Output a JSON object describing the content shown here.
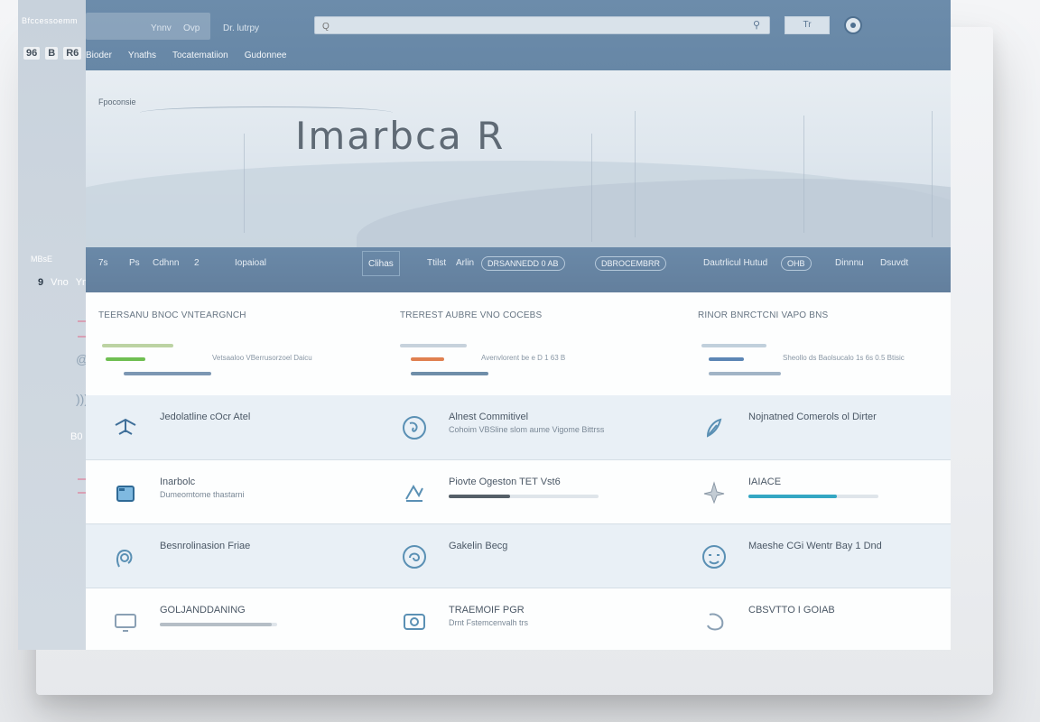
{
  "rail": {
    "brand": "Bfccessoemm",
    "tools": [
      "96",
      "B",
      "R6"
    ],
    "section": "MBsE",
    "nav": [
      "9",
      "Vno",
      "Ynno"
    ],
    "badge": "B0"
  },
  "topbar": {
    "links": [
      "Ynnv",
      "Ovp",
      "Dr. lutrpy"
    ],
    "search": {
      "placeholder": "Q",
      "icon": "search-icon"
    },
    "button_label": "Tr",
    "subnav": [
      "Bioder",
      "Ynaths",
      "Tocatematiion",
      "Gudonnee"
    ]
  },
  "hero": {
    "kicker": "Fpoconsie",
    "title": "Imarbca R"
  },
  "toolbar": {
    "items": [
      "7s",
      "Ps",
      "Cdhnn",
      "2"
    ],
    "filter_label": "Iopaioal",
    "box1": "Clihas",
    "box2_prefix": "Ttilst",
    "box2_label": "Arlin",
    "pill1": "DRSANNEDD 0 AB",
    "pill2": "DBROCEMBRR",
    "link1": "Dautrlicul Hutud",
    "pill3": "OHB",
    "link2": "Dinnnu",
    "link3": "Dsuvdt"
  },
  "summary": [
    {
      "title": "TEERSANU BNOC VNTEARGNCH",
      "note": "Vetsaaloo VBerrusorzoel Daicu",
      "bars": [
        {
          "color": "#bcd3a3",
          "value": 0.55
        },
        {
          "color": "#6fbf52",
          "value": 0.31
        },
        {
          "color": "#7c97b3",
          "value": 0.68
        }
      ]
    },
    {
      "title": "TREREST AUBRE VNO COCEBS",
      "note": "Avenvlorent be e D 1 63 B",
      "bars": [
        {
          "color": "#c7d2dc",
          "value": 0.52
        },
        {
          "color": "#e08050",
          "value": 0.26
        },
        {
          "color": "#6f8ea9",
          "value": 0.6
        }
      ]
    },
    {
      "title": "RINOR BNRCTCNI VAPO BNS",
      "note": "Sheollo ds Baolsucalo 1s 6s 0.5 Btisic",
      "bars": [
        {
          "color": "#c1d0dc",
          "value": 0.5
        },
        {
          "color": "#5c86b5",
          "value": 0.27
        },
        {
          "color": "#a1b4c6",
          "value": 0.56
        }
      ]
    }
  ],
  "rows": [
    {
      "style": "alt",
      "cells": [
        {
          "icon": "windmill-icon",
          "title": "Jedolatline cOcr Atel",
          "sub": ""
        },
        {
          "icon": "compass-icon",
          "title": "Alnest Commitivel",
          "sub": "Cohoim VBSline slom aume Vigome Bittrss"
        },
        {
          "icon": "feather-icon",
          "title": "Nojnatned Comerols ol Dirter",
          "sub": ""
        }
      ]
    },
    {
      "style": "white",
      "cells": [
        {
          "icon": "folder-icon",
          "title": "Inarbolc",
          "sub": "Dumeomtome thastarni",
          "bar": null
        },
        {
          "icon": "chart-icon",
          "title": "Piovte Ogeston TET Vst6",
          "sub": "",
          "bar": {
            "value": 0.41,
            "color": "#555f68"
          }
        },
        {
          "icon": "leaf-icon",
          "title": "IAIACE",
          "sub": "",
          "bar": {
            "value": 0.68,
            "color": "#34a7c3"
          }
        }
      ]
    },
    {
      "style": "alt",
      "cells": [
        {
          "icon": "loop-icon",
          "title": "Besnrolinasion Friae",
          "sub": ""
        },
        {
          "icon": "spiral-icon",
          "title": "Gakelin Becg",
          "sub": ""
        },
        {
          "icon": "face-icon",
          "title": "Maeshe CGi Wentr Bay 1 Dnd",
          "sub": ""
        }
      ]
    },
    {
      "style": "white",
      "cells": [
        {
          "icon": "monitor-icon",
          "title": "GOLJANDDANING",
          "sub": "",
          "bar": {
            "value": 0.95,
            "color": "#b5bec6"
          }
        },
        {
          "icon": "camera-icon",
          "title": "TRAEMOIF PGR",
          "sub": "Drnt Fstemcenvalh trs"
        },
        {
          "icon": "circle-icon",
          "title": "CBSVTTO I GOIAB",
          "sub": ""
        }
      ]
    }
  ]
}
